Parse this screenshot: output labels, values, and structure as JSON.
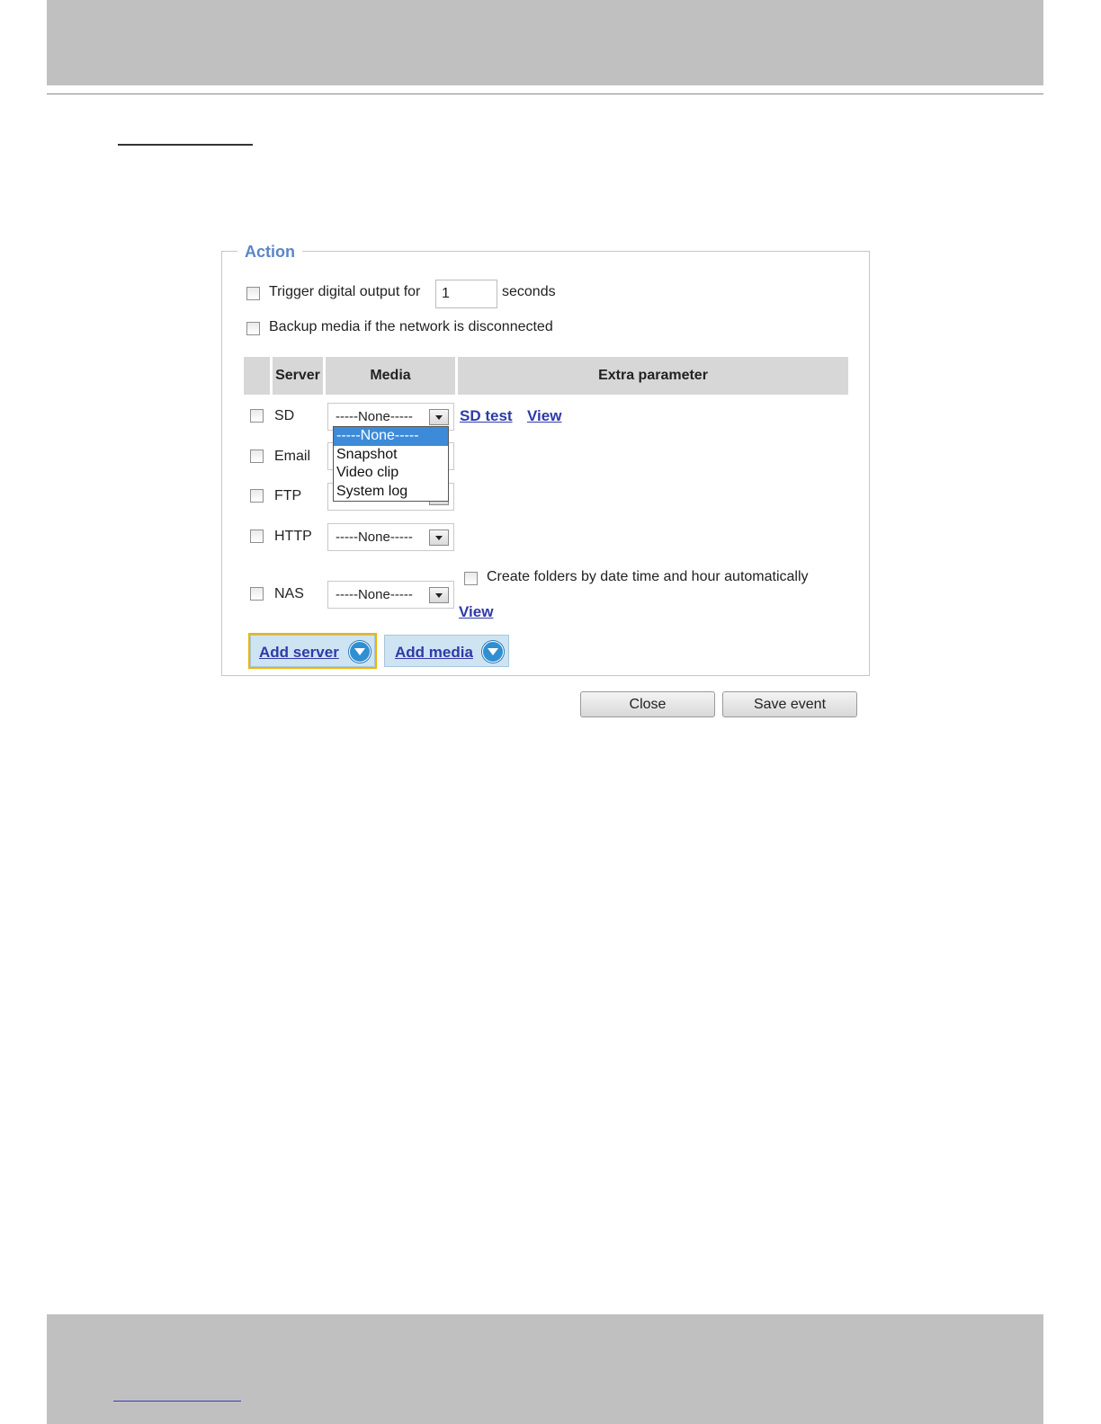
{
  "action": {
    "legend": "Action",
    "trigger_label": "Trigger digital output for",
    "trigger_value": "1",
    "trigger_unit": "seconds",
    "backup_label": "Backup media if the network is disconnected"
  },
  "table": {
    "headers": {
      "server": "Server",
      "media": "Media",
      "extra": "Extra parameter"
    },
    "rows": {
      "sd": {
        "label": "SD",
        "media": "-----None-----",
        "sd_test": "SD test",
        "view": "View"
      },
      "email": {
        "label": "Email"
      },
      "ftp": {
        "label": "FTP"
      },
      "http": {
        "label": "HTTP",
        "media": "-----None-----"
      },
      "nas": {
        "label": "NAS",
        "media": "-----None-----",
        "create_folders": "Create folders by date time and hour automatically",
        "view": "View"
      }
    }
  },
  "dropdown": {
    "options": [
      "-----None-----",
      "Snapshot",
      "Video clip",
      "System log"
    ],
    "selected": "-----None-----"
  },
  "buttons": {
    "add_server": "Add server",
    "add_media": "Add media",
    "close": "Close",
    "save_event": "Save event"
  },
  "icons": {
    "expand": "chevron-down-circle-icon",
    "select_arrow": "select-arrow-icon"
  },
  "colors": {
    "legend": "#5b86c5",
    "link": "#2f3aa8",
    "dropdown_highlight": "#3d8bd8",
    "add_button_bg": "#cfe4f3",
    "focus_outline": "#f0b400",
    "header_bg": "#d7d7d7"
  }
}
